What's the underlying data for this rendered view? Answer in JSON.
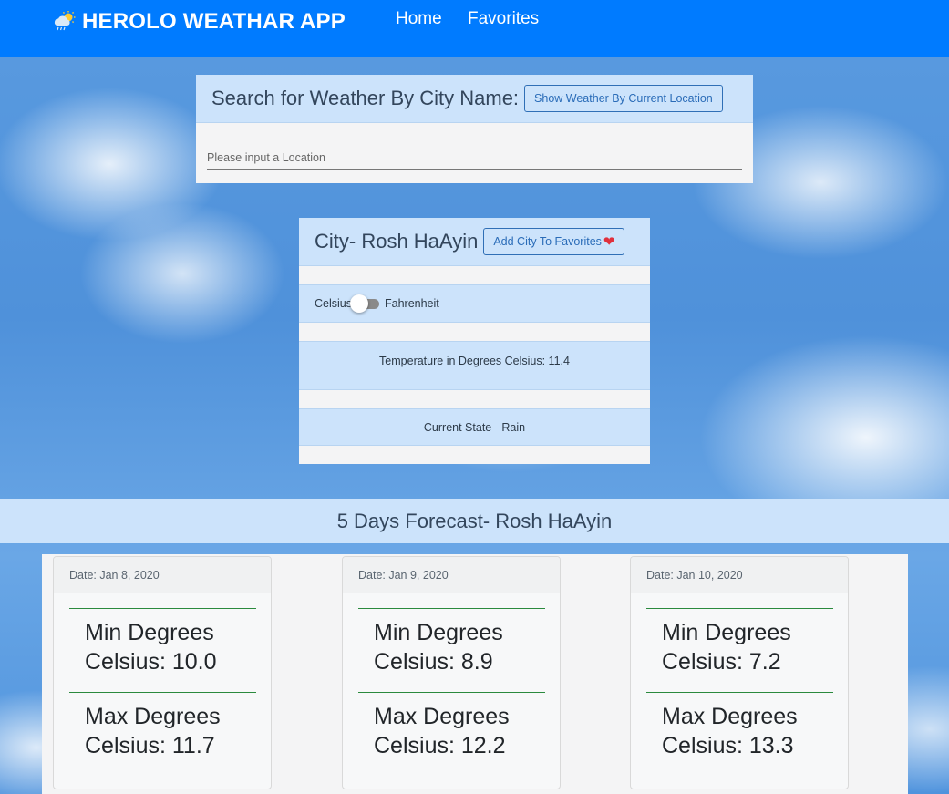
{
  "app": {
    "title": "HEROLO WEATHAR APP",
    "brand_icon": "weather-partly-cloudy-rain-icon"
  },
  "nav": {
    "home": "Home",
    "favorites": "Favorites"
  },
  "search": {
    "title": "Search for Weather By City Name:",
    "current_location_button": "Show Weather By Current Location",
    "placeholder": "Please input a Location"
  },
  "city": {
    "title": "City- Rosh HaAyin",
    "add_favorite_button": "Add City To Favorites",
    "favorite_icon": "heart-icon",
    "unit_left": "Celsius",
    "unit_right": "Fahrenheit",
    "unit_toggle_on": false,
    "temperature_text": "Temperature in Degrees Celsius: 11.4",
    "state_text": "Current State - Rain"
  },
  "forecast": {
    "title": "5 Days Forecast- Rosh HaAyin",
    "days": [
      {
        "date": "Date: Jan 8, 2020",
        "min_line1": "Min Degrees",
        "min_line2": "Celsius: 10.0",
        "max_line1": "Max Degrees",
        "max_line2": "Celsius: 11.7"
      },
      {
        "date": "Date: Jan 9, 2020",
        "min_line1": "Min Degrees",
        "min_line2": "Celsius: 8.9",
        "max_line1": "Max Degrees",
        "max_line2": "Celsius: 12.2"
      },
      {
        "date": "Date: Jan 10, 2020",
        "min_line1": "Min Degrees",
        "min_line2": "Celsius: 7.2",
        "max_line1": "Max Degrees",
        "max_line2": "Celsius: 13.3"
      }
    ]
  },
  "colors": {
    "navbar": "#007bff",
    "panel_header": "#cce3fb",
    "divider": "#2b8a3e",
    "heart": "#e0303c"
  }
}
